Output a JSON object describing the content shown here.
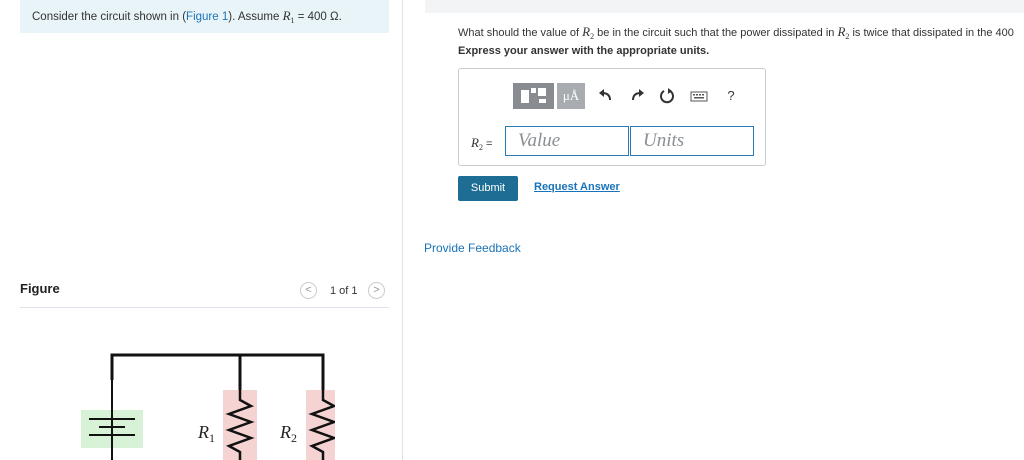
{
  "problem": {
    "prefix": "Consider the circuit shown in (",
    "figure_link": "Figure 1",
    "middle": "). Assume ",
    "var": "R",
    "var_sub": "1",
    "assign": " = 400 Ω."
  },
  "figure": {
    "heading": "Figure",
    "counter": "1 of 1",
    "prev_icon": "chevron-left-icon",
    "next_icon": "chevron-right-icon",
    "r1_label": "R",
    "r1_sub": "1",
    "r2_label": "R",
    "r2_sub": "2"
  },
  "question": {
    "text_before": "What should the value of ",
    "var": "R",
    "var_sub": "2",
    "text_after": " be in the circuit such that the power dissipated in ",
    "var2": "R",
    "var2_sub": "2",
    "text_end": " is twice that dissipated in the 400"
  },
  "instruction": "Express your answer with the appropriate units.",
  "answer": {
    "label": "R",
    "label_sub": "2",
    "equals": " =",
    "value_placeholder": "Value",
    "units_placeholder": "Units",
    "toolbar": {
      "units_label": "μÅ",
      "icons": [
        "templates-icon",
        "units-icon",
        "undo-icon",
        "redo-icon",
        "reset-icon",
        "keyboard-icon",
        "help-icon"
      ],
      "help_label": "?"
    }
  },
  "buttons": {
    "submit": "Submit",
    "request_answer": "Request Answer",
    "feedback": "Provide Feedback"
  },
  "colors": {
    "accent": "#1e6d94",
    "link": "#1a73b8",
    "problem_bg": "#e9f4f8",
    "battery_fill": "#d7f2d7",
    "resistor_fill": "#f6d3d3"
  }
}
